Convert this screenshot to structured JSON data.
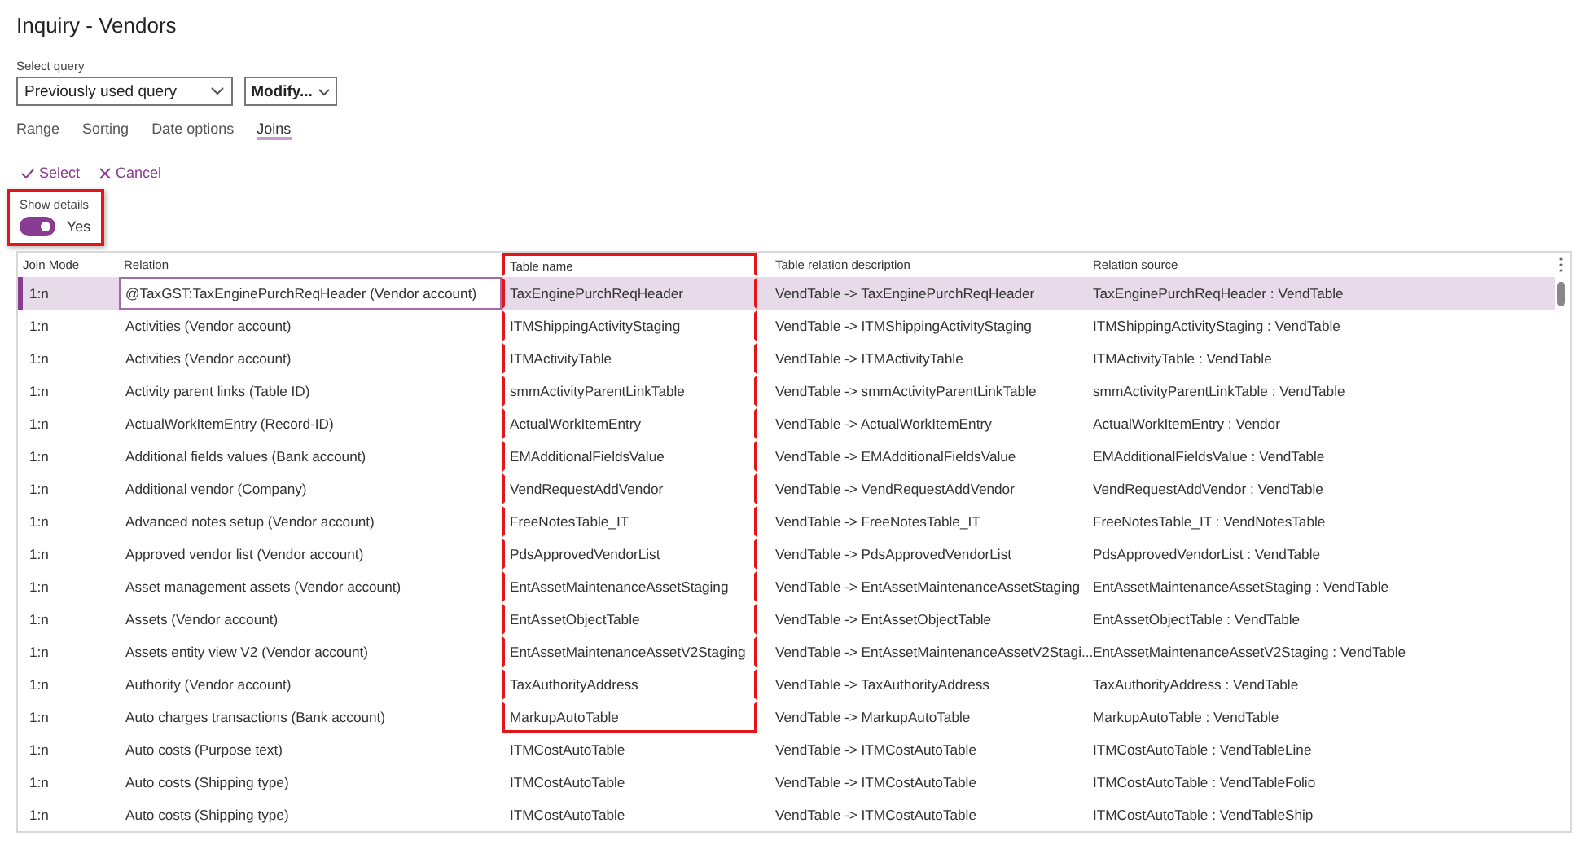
{
  "window": {
    "title": "Inquiry - Vendors"
  },
  "query": {
    "label": "Select query",
    "value": "Previously used query",
    "modify": "Modify..."
  },
  "tabs": [
    {
      "label": "Range",
      "selected": false
    },
    {
      "label": "Sorting",
      "selected": false
    },
    {
      "label": "Date options",
      "selected": false
    },
    {
      "label": "Joins",
      "selected": true
    }
  ],
  "actions": [
    {
      "kind": "select",
      "label": "Select"
    },
    {
      "kind": "cancel",
      "label": "Cancel"
    }
  ],
  "show_details": {
    "label": "Show details",
    "on": true,
    "value": "Yes",
    "highlighted": true
  },
  "table": {
    "columns": [
      {
        "label": "Join Mode"
      },
      {
        "label": "Relation"
      },
      {
        "label": "Table name"
      },
      {
        "label": "Table relation description"
      },
      {
        "label": "Relation source"
      }
    ],
    "rows": [
      {
        "selected": true,
        "highlighted": true,
        "cells": [
          "1:n",
          "@TaxGST:TaxEnginePurchReqHeader  (Vendor account)",
          "TaxEnginePurchReqHeader",
          "VendTable -> TaxEnginePurchReqHeader",
          "TaxEnginePurchReqHeader : VendTable"
        ]
      },
      {
        "selected": false,
        "highlighted": true,
        "cells": [
          "1:n",
          "Activities  (Vendor account)",
          "ITMShippingActivityStaging",
          "VendTable -> ITMShippingActivityStaging",
          "ITMShippingActivityStaging : VendTable"
        ]
      },
      {
        "selected": false,
        "highlighted": true,
        "cells": [
          "1:n",
          "Activities  (Vendor account)",
          "ITMActivityTable",
          "VendTable -> ITMActivityTable",
          "ITMActivityTable : VendTable"
        ]
      },
      {
        "selected": false,
        "highlighted": true,
        "cells": [
          "1:n",
          "Activity parent links  (Table ID)",
          "smmActivityParentLinkTable",
          "VendTable -> smmActivityParentLinkTable",
          "smmActivityParentLinkTable : VendTable"
        ]
      },
      {
        "selected": false,
        "highlighted": true,
        "cells": [
          "1:n",
          "ActualWorkItemEntry  (Record-ID)",
          "ActualWorkItemEntry",
          "VendTable -> ActualWorkItemEntry",
          "ActualWorkItemEntry : Vendor"
        ]
      },
      {
        "selected": false,
        "highlighted": true,
        "cells": [
          "1:n",
          "Additional fields values  (Bank account)",
          "EMAdditionalFieldsValue",
          "VendTable -> EMAdditionalFieldsValue",
          "EMAdditionalFieldsValue : VendTable"
        ]
      },
      {
        "selected": false,
        "highlighted": true,
        "cells": [
          "1:n",
          "Additional vendor  (Company)",
          "VendRequestAddVendor",
          "VendTable -> VendRequestAddVendor",
          "VendRequestAddVendor : VendTable"
        ]
      },
      {
        "selected": false,
        "highlighted": true,
        "cells": [
          "1:n",
          "Advanced notes setup  (Vendor account)",
          "FreeNotesTable_IT",
          "VendTable -> FreeNotesTable_IT",
          "FreeNotesTable_IT : VendNotesTable"
        ]
      },
      {
        "selected": false,
        "highlighted": true,
        "cells": [
          "1:n",
          "Approved vendor list  (Vendor account)",
          "PdsApprovedVendorList",
          "VendTable -> PdsApprovedVendorList",
          "PdsApprovedVendorList : VendTable"
        ]
      },
      {
        "selected": false,
        "highlighted": true,
        "cells": [
          "1:n",
          "Asset management assets  (Vendor account)",
          "EntAssetMaintenanceAssetStaging",
          "VendTable -> EntAssetMaintenanceAssetStaging",
          "EntAssetMaintenanceAssetStaging : VendTable"
        ]
      },
      {
        "selected": false,
        "highlighted": true,
        "cells": [
          "1:n",
          "Assets  (Vendor account)",
          "EntAssetObjectTable",
          "VendTable -> EntAssetObjectTable",
          "EntAssetObjectTable : VendTable"
        ]
      },
      {
        "selected": false,
        "highlighted": true,
        "cells": [
          "1:n",
          "Assets entity view V2  (Vendor account)",
          "EntAssetMaintenanceAssetV2Staging",
          "VendTable -> EntAssetMaintenanceAssetV2Stagi...",
          "EntAssetMaintenanceAssetV2Staging : VendTable"
        ]
      },
      {
        "selected": false,
        "highlighted": true,
        "cells": [
          "1:n",
          "Authority  (Vendor account)",
          "TaxAuthorityAddress",
          "VendTable -> TaxAuthorityAddress",
          "TaxAuthorityAddress : VendTable"
        ]
      },
      {
        "selected": false,
        "highlighted": true,
        "cells": [
          "1:n",
          "Auto charges transactions  (Bank account)",
          "MarkupAutoTable",
          "VendTable -> MarkupAutoTable",
          "MarkupAutoTable : VendTable"
        ]
      },
      {
        "selected": false,
        "highlighted": false,
        "cells": [
          "1:n",
          "Auto costs  (Purpose text)",
          "ITMCostAutoTable",
          "VendTable -> ITMCostAutoTable",
          "ITMCostAutoTable : VendTableLine"
        ]
      },
      {
        "selected": false,
        "highlighted": false,
        "cells": [
          "1:n",
          "Auto costs  (Shipping type)",
          "ITMCostAutoTable",
          "VendTable -> ITMCostAutoTable",
          "ITMCostAutoTable : VendTableFolio"
        ]
      },
      {
        "selected": false,
        "highlighted": false,
        "cells": [
          "1:n",
          "Auto costs  (Shipping type)",
          "ITMCostAutoTable",
          "VendTable -> ITMCostAutoTable",
          "ITMCostAutoTable : VendTableShip"
        ]
      }
    ]
  }
}
